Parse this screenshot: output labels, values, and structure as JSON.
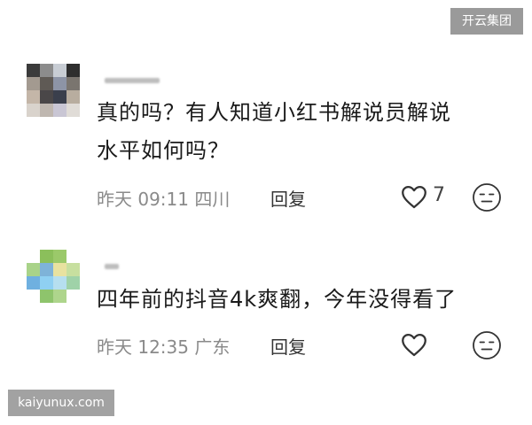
{
  "watermarks": {
    "top": "开云集团",
    "bottom": "kaiyunux.com"
  },
  "comments": [
    {
      "text_line1": "真的吗？有人知道小红书解说员解说",
      "text_line2": "水平如何吗？",
      "meta": "昨天 09:11 四川",
      "reply": "回复",
      "like_count": "7"
    },
    {
      "text_line1": "四年前的抖音4k爽翻，今年没得看了",
      "meta": "昨天 12:35 广东",
      "reply": "回复"
    }
  ],
  "icons": {
    "like": "heart-icon",
    "dislike": "unamused-face-icon"
  }
}
